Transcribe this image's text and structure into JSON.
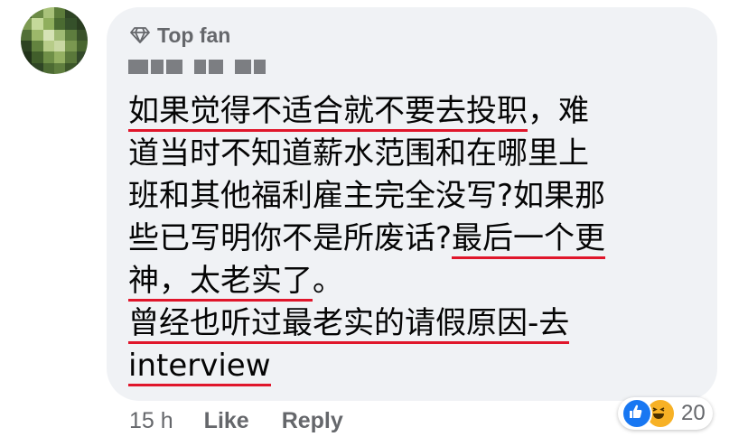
{
  "comment": {
    "badge_label": "Top fan",
    "lines": [
      [
        {
          "t": "如果觉得不适合就不要去投职",
          "u": true
        },
        {
          "t": "，难",
          "u": false
        }
      ],
      [
        {
          "t": "道当时不知道薪水范围和在哪里上",
          "u": false
        }
      ],
      [
        {
          "t": "班和其他福利雇主完全没写?如果那",
          "u": false
        }
      ],
      [
        {
          "t": "些已写明你不是所废话?",
          "u": false
        },
        {
          "t": "最后一个更",
          "u": true
        }
      ],
      [
        {
          "t": "神，太老实了",
          "u": true
        },
        {
          "t": "。",
          "u": false
        }
      ],
      [
        {
          "t": "曾经也听过最老实的请假原因-去",
          "u": true
        }
      ],
      [
        {
          "t": "interview",
          "u": true
        }
      ]
    ]
  },
  "footer": {
    "time": "15 h",
    "like_label": "Like",
    "reply_label": "Reply"
  },
  "reactions": {
    "icons": [
      "like-icon",
      "haha-icon"
    ],
    "count": "20"
  },
  "colors": {
    "underline": "#e0162b",
    "bubble": "#f0f2f5",
    "meta": "#65676b",
    "like": "#1877f2",
    "haha": "#f7b125"
  },
  "avatar_cells": [
    "#3f5a2d",
    "#6b8a45",
    "#a9c27a",
    "#5c7c3a",
    "#2e4424",
    "#1f2d18",
    "#7d9a52",
    "#c5d99a",
    "#8fae5d",
    "#4a6a31",
    "#35502a",
    "#2a3d20",
    "#516f36",
    "#9cb86a",
    "#d6e3b5",
    "#a0ba74",
    "#5e7d3e",
    "#3a522a",
    "#2d4322",
    "#63833f",
    "#b7cc88",
    "#c9d8a3",
    "#7a9850",
    "#48652f",
    "#22331a",
    "#415e2b",
    "#6f8f47",
    "#94b062",
    "#5a783a",
    "#33492a",
    "#1b2915",
    "#2f4525",
    "#4d6b33",
    "#5f7e3e",
    "#3c5629",
    "#26381e"
  ]
}
